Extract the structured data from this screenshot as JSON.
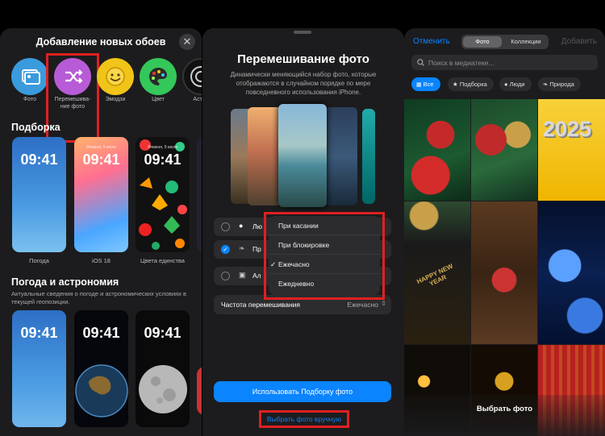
{
  "left_panel": {
    "title": "Добавление новых обоев",
    "categories": [
      {
        "label": "Фото",
        "icon": "photos-icon",
        "color": "#3a9bdc"
      },
      {
        "label": "Перемешива-\nние фото",
        "icon": "shuffle-icon",
        "color": "#b85bd6"
      },
      {
        "label": "Эмодзи",
        "icon": "emoji-icon",
        "color": "#f0c419"
      },
      {
        "label": "Цвет",
        "icon": "palette-icon",
        "color": "#34c759"
      },
      {
        "label": "Астро",
        "icon": "astronomy-icon",
        "color": "#111111"
      }
    ],
    "section1": "Подборка",
    "featured": [
      {
        "label": "Погода",
        "time": "09:41",
        "date": ""
      },
      {
        "label": "iOS 18",
        "time": "09:41",
        "date": "Ячменя, 9 июля"
      },
      {
        "label": "Цвета единства",
        "time": "09:41",
        "date": "Ячменя, 9 июля"
      }
    ],
    "section2": "Погода и астрономия",
    "section2_desc": "Актуальные сведения о погоде и астрономических условиях в текущей геопозиции.",
    "weather": [
      {
        "time": "09:41"
      },
      {
        "time": "09:41"
      },
      {
        "time": "09:41"
      }
    ]
  },
  "middle_panel": {
    "title": "Перемешивание фото",
    "description": "Динамически меняющийся набор фото, которые отображаются в случайном порядке по мере повседневного использования iPhone.",
    "options": [
      {
        "label": "Лю",
        "icon": "person-icon",
        "selected": false
      },
      {
        "label": "Пр",
        "icon": "leaf-icon",
        "selected": true
      },
      {
        "label": "Ал",
        "icon": "album-icon",
        "selected": false
      }
    ],
    "menu_items": [
      "При касании",
      "При блокировке",
      "Ежечасно",
      "Ежедневно"
    ],
    "menu_checked": "✓",
    "freq_label": "Частота перемешивания",
    "freq_value": "Ежечасно",
    "use_button": "Использовать Подборку фото",
    "manual_link": "Выбрать фото вручную"
  },
  "right_panel": {
    "cancel": "Отменить",
    "tab_photo": "Фото",
    "tab_collections": "Коллекции",
    "add": "Добавить",
    "search_placeholder": "Поиск в медиатеке...",
    "chips": [
      "Все",
      "Подборка",
      "Люди",
      "Природа"
    ],
    "tile_text_2025": "2025",
    "tile_text_newyear": "HAPPY NEW YEAR",
    "bottom_label": "Выбрать фото"
  }
}
